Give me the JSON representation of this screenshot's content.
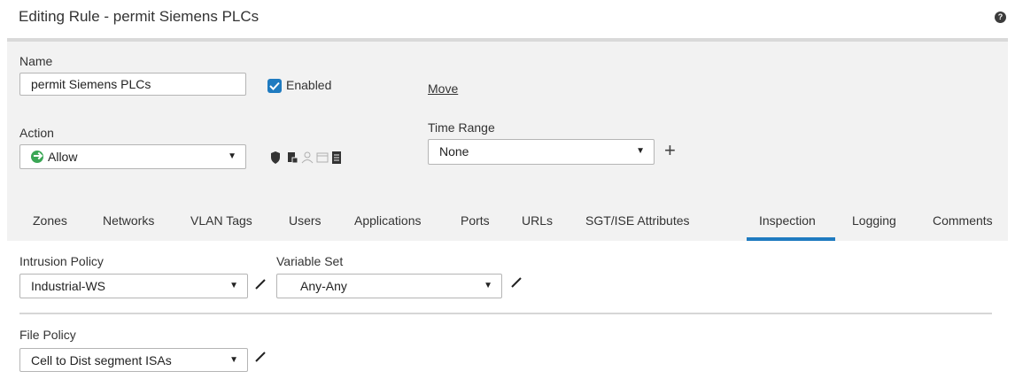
{
  "header": {
    "title": "Editing Rule - permit Siemens PLCs",
    "help_icon": "?"
  },
  "name": {
    "label": "Name",
    "value": "permit Siemens PLCs"
  },
  "enabled": {
    "label": "Enabled",
    "checked": true
  },
  "move": {
    "label": "Move"
  },
  "action": {
    "label": "Action",
    "value": "Allow",
    "icons": [
      "shield-icon",
      "log-icon",
      "user-icon",
      "window-icon",
      "document-icon"
    ]
  },
  "time_range": {
    "label": "Time Range",
    "value": "None"
  },
  "tabs": [
    {
      "label": "Zones"
    },
    {
      "label": "Networks"
    },
    {
      "label": "VLAN Tags"
    },
    {
      "label": "Users"
    },
    {
      "label": "Applications"
    },
    {
      "label": "Ports"
    },
    {
      "label": "URLs"
    },
    {
      "label": "SGT/ISE Attributes"
    },
    {
      "label": "Inspection",
      "active": true
    },
    {
      "label": "Logging"
    },
    {
      "label": "Comments"
    }
  ],
  "intrusion_policy": {
    "label": "Intrusion Policy",
    "value": "Industrial-WS"
  },
  "variable_set": {
    "label": "Variable Set",
    "value": "Any-Any"
  },
  "file_policy": {
    "label": "File Policy",
    "value": "Cell to Dist segment ISAs"
  },
  "colors": {
    "accent": "#1f7bc0",
    "allow": "#3aa655",
    "panel": "#f2f2f2"
  }
}
